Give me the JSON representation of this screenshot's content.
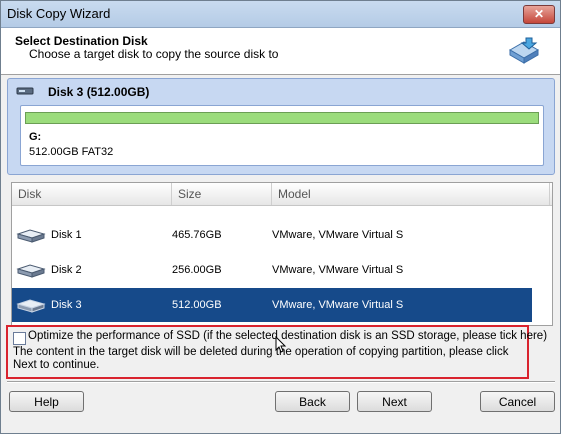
{
  "window": {
    "title": "Disk Copy Wizard",
    "close_glyph": "✕"
  },
  "header": {
    "title": "Select Destination Disk",
    "subtitle": "Choose a target disk to copy the source disk to",
    "icon": "disk-copy-icon"
  },
  "selected_disk": {
    "title": "Disk 3 (512.00GB)",
    "partition_letter": "G:",
    "partition_info": "512.00GB FAT32",
    "bar_color": "#9bdc7c"
  },
  "disk_list": {
    "columns": [
      "Disk",
      "Size",
      "Model"
    ],
    "rows": [
      {
        "disk": "Disk 1",
        "size": "465.76GB",
        "model": "VMware, VMware Virtual S"
      },
      {
        "disk": "Disk 2",
        "size": "256.00GB",
        "model": "VMware, VMware Virtual S"
      },
      {
        "disk": "Disk 3",
        "size": "512.00GB",
        "model": "VMware, VMware Virtual S"
      }
    ],
    "selected_index": 2,
    "selected_color": "#164a8a"
  },
  "options": {
    "ssd_label": "Optimize the performance of SSD (if the selected destination disk is an SSD storage, please tick here)",
    "ssd_checked": false,
    "note": "The content in the target disk will be deleted during the operation of copying partition, please click Next to continue.",
    "highlight_color": "#d9232e"
  },
  "buttons": {
    "help": "Help",
    "back": "Back",
    "next": "Next",
    "cancel": "Cancel"
  }
}
